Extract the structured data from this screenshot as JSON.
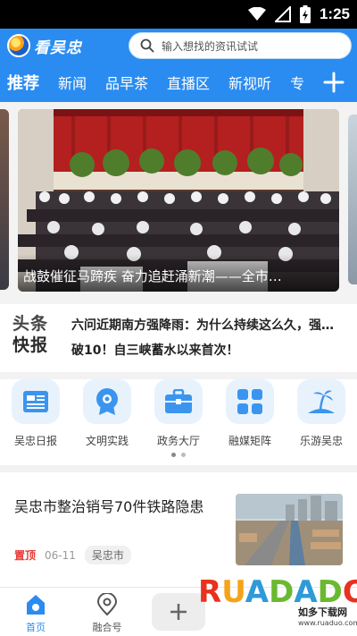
{
  "status_bar": {
    "time": "1:25",
    "icons": [
      "wifi-icon",
      "signal-icon",
      "battery-charging-icon"
    ]
  },
  "header": {
    "app_name": "看吴忠",
    "search_placeholder": "输入想找的资讯试试"
  },
  "channels": {
    "tabs": [
      {
        "label": "推荐",
        "active": true
      },
      {
        "label": "新闻",
        "active": false
      },
      {
        "label": "品早茶",
        "active": false
      },
      {
        "label": "直播区",
        "active": false
      },
      {
        "label": "新视听",
        "active": false
      },
      {
        "label": "专",
        "active": false
      }
    ],
    "add_icon": "plus-icon"
  },
  "banner": {
    "caption": "战鼓催征马蹄疾 奋力追赶涌新潮——全市…"
  },
  "headlines": {
    "badge_top": "头条",
    "badge_bottom": "快报",
    "items": [
      "六问近期南方强降雨：为什么持续这么久，强…",
      "破10！自三峡蓄水以来首次！"
    ]
  },
  "quick_links": [
    {
      "label": "吴忠日报",
      "icon": "newspaper-icon"
    },
    {
      "label": "文明实践",
      "icon": "flower-badge-icon"
    },
    {
      "label": "政务大厅",
      "icon": "briefcase-icon"
    },
    {
      "label": "融媒矩阵",
      "icon": "grid-icon"
    },
    {
      "label": "乐游吴忠",
      "icon": "palm-beach-icon"
    }
  ],
  "quick_pager": {
    "pages": 2,
    "current": 1
  },
  "news": [
    {
      "title": "吴忠市整治销号70件铁路隐患",
      "pin": "置顶",
      "date": "06-11",
      "tag": "吴忠市"
    }
  ],
  "bottom_nav": {
    "items": [
      {
        "label": "首页",
        "icon": "home-icon",
        "active": true
      },
      {
        "label": "融合号",
        "icon": "location-pin-icon",
        "active": false
      }
    ],
    "add_icon": "plus-icon"
  },
  "watermark": {
    "brand": "RUADADO",
    "name": "如多下载网",
    "url": "www.ruaduo.com"
  },
  "colors": {
    "brand_blue": "#2a8cf0",
    "pin_red": "#e53935"
  }
}
